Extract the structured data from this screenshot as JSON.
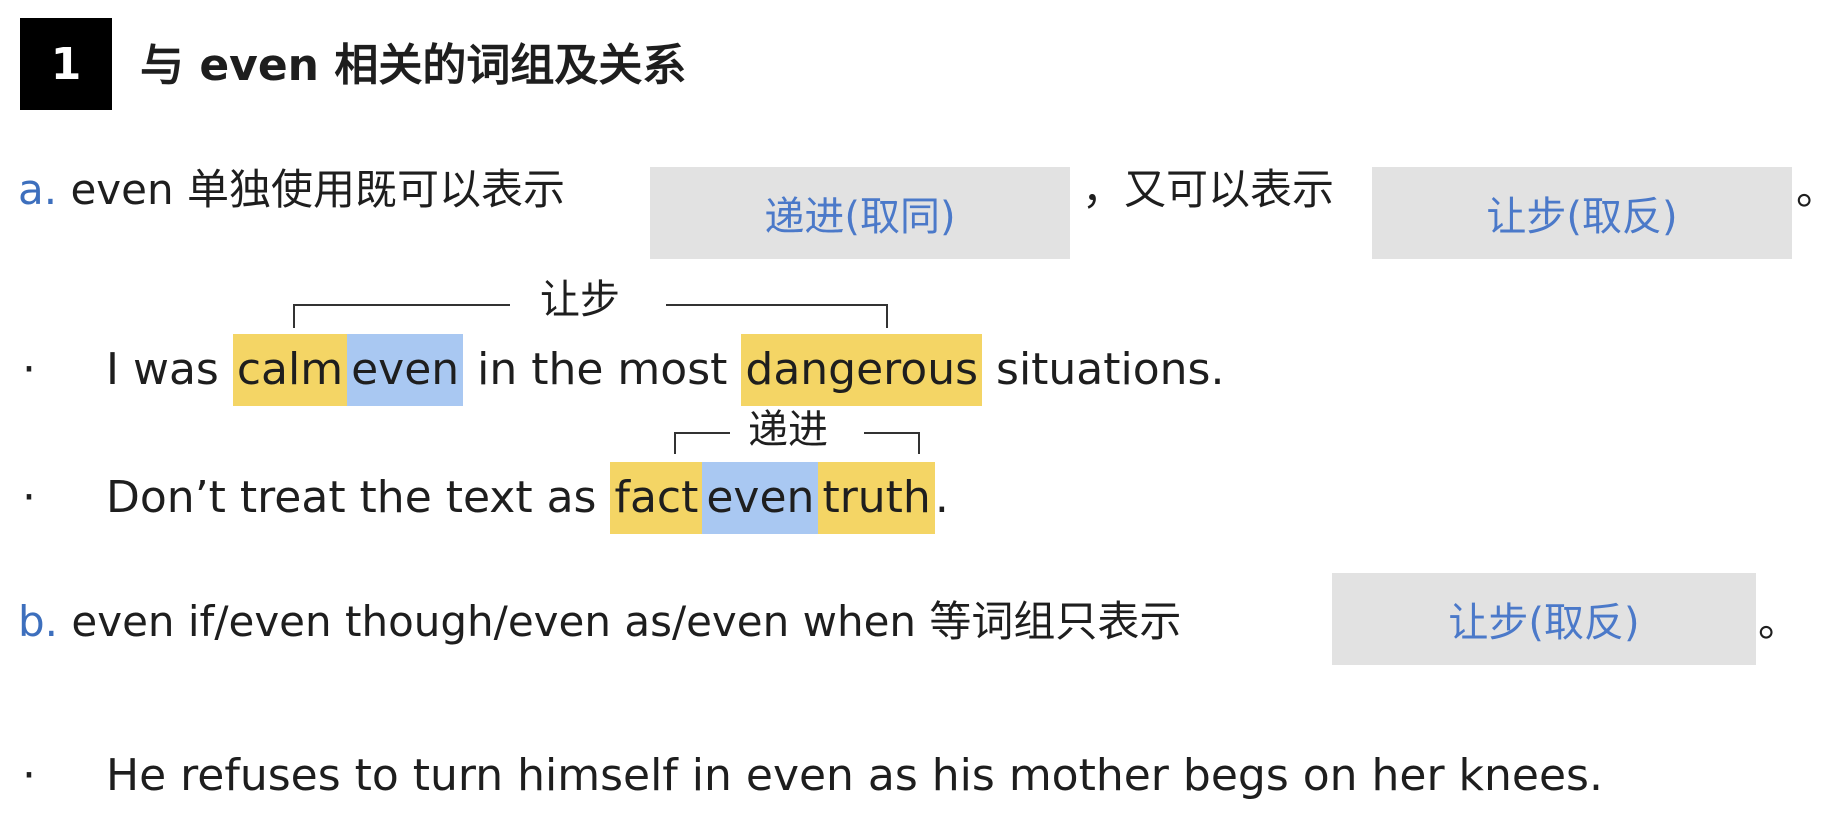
{
  "section": {
    "number": "1",
    "title": "与 even 相关的词组及关系"
  },
  "point_a": {
    "marker": "a.",
    "text_before": "even 单独使用既可以表示",
    "blank1": "递进(取同)",
    "text_middle": "，又可以表示",
    "blank2": "让步(取反)",
    "text_end": "。"
  },
  "example1": {
    "bullet": "·",
    "bracket_label": "让步",
    "parts": [
      "I was ",
      "calm",
      "even",
      " in the most ",
      "dangerous",
      " situations."
    ]
  },
  "example2": {
    "bullet": "·",
    "bracket_label": "递进",
    "parts": [
      "Don’t treat the text as ",
      "fact",
      "even",
      "truth",
      "."
    ]
  },
  "point_b": {
    "marker": "b.",
    "text_before": "even if/even though/even as/even when 等词组只表示",
    "blank": "让步(取反)",
    "text_end": "。"
  },
  "example3": {
    "bullet": "·",
    "text": "He refuses to turn himself in even as his mother begs on her knees."
  },
  "colors": {
    "highlight_yellow": "#f4d565",
    "highlight_blue": "#a9c8f2",
    "blank_bg": "#e2e2e2",
    "blank_text": "#4b79c9",
    "marker": "#3d6fbd"
  }
}
